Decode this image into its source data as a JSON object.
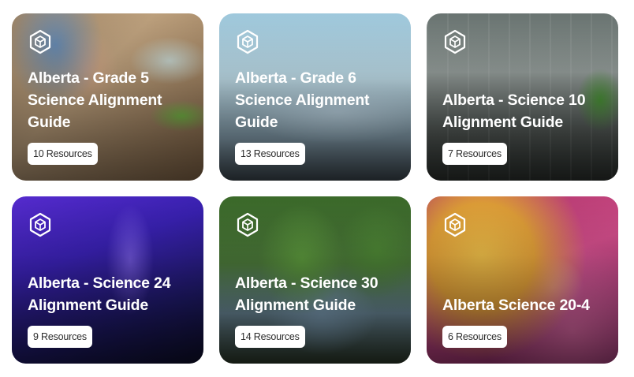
{
  "cards": [
    {
      "title_line1": "Alberta - Grade 5",
      "title_line2": "Science Alignment",
      "title_line3": "Guide",
      "count": "10 Resources"
    },
    {
      "title_line1": "Alberta - Grade 6",
      "title_line2": "Science Alignment",
      "title_line3": "Guide",
      "count": "13 Resources"
    },
    {
      "title_line1": "Alberta - Science 10",
      "title_line2": "Alignment Guide",
      "title_line3": "",
      "count": "7 Resources"
    },
    {
      "title_line1": "Alberta - Science 24",
      "title_line2": "Alignment Guide",
      "title_line3": "",
      "count": "9 Resources"
    },
    {
      "title_line1": "Alberta - Science 30",
      "title_line2": "Alignment Guide",
      "title_line3": "",
      "count": "14 Resources"
    },
    {
      "title_line1": "Alberta Science 20-4",
      "title_line2": "",
      "title_line3": "",
      "count": "6 Resources"
    }
  ],
  "colors": {
    "title_text": "#ffffff",
    "count_bg": "#ffffff",
    "count_text": "#2b2b2b"
  },
  "icons": {
    "card_badge": "hexagon-cube-icon"
  }
}
